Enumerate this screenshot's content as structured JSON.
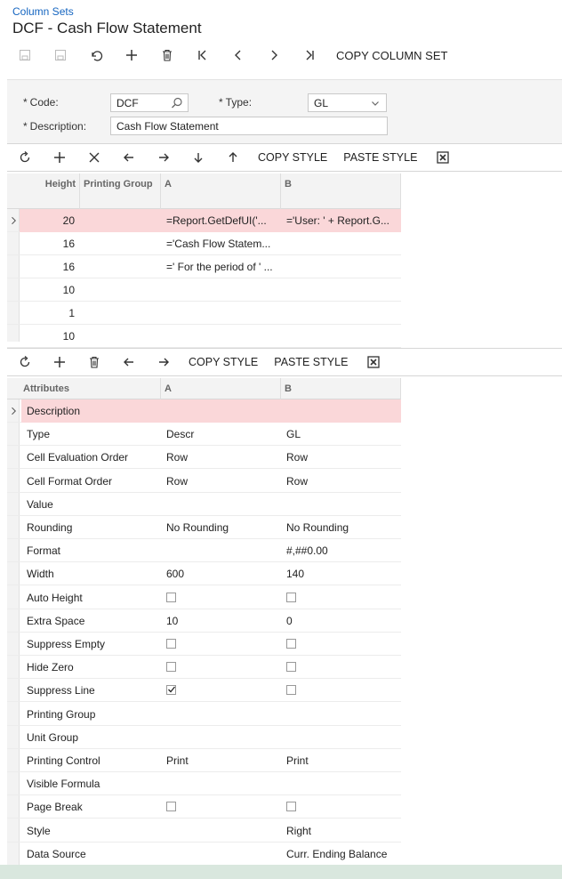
{
  "breadcrumb": "Column Sets",
  "title": "DCF - Cash Flow Statement",
  "main_toolbar": {
    "copy_label": "COPY COLUMN SET"
  },
  "form": {
    "code_label": "Code:",
    "code_value": "DCF",
    "type_label": "Type:",
    "type_value": "GL",
    "description_label": "Description:",
    "description_value": "Cash Flow Statement"
  },
  "top_grid_toolbar": {
    "copy_style": "COPY STYLE",
    "paste_style": "PASTE STYLE"
  },
  "top_grid": {
    "headers": [
      "Height",
      "Printing Group",
      "A",
      "B"
    ],
    "rows": [
      {
        "height": "20",
        "printing_group": "",
        "a": "=Report.GetDefUI('...",
        "b": "='User: ' + Report.G..."
      },
      {
        "height": "16",
        "printing_group": "",
        "a": "='Cash Flow Statem...",
        "b": ""
      },
      {
        "height": "16",
        "printing_group": "",
        "a": "=' For the period of ' ...",
        "b": ""
      },
      {
        "height": "10",
        "printing_group": "",
        "a": "",
        "b": ""
      },
      {
        "height": "1",
        "printing_group": "",
        "a": "",
        "b": ""
      },
      {
        "height": "10",
        "printing_group": "",
        "a": "",
        "b": ""
      }
    ]
  },
  "bottom_grid_toolbar": {
    "copy_style": "COPY STYLE",
    "paste_style": "PASTE STYLE"
  },
  "attr_grid": {
    "headers": [
      "Attributes",
      "A",
      "B"
    ],
    "rows": [
      {
        "attr": "Description",
        "a": "",
        "b": ""
      },
      {
        "attr": "Type",
        "a": "Descr",
        "b": "GL"
      },
      {
        "attr": "Cell Evaluation Order",
        "a": "Row",
        "b": "Row"
      },
      {
        "attr": "Cell Format Order",
        "a": "Row",
        "b": "Row"
      },
      {
        "attr": "Value",
        "a": "",
        "b": ""
      },
      {
        "attr": "Rounding",
        "a": "No Rounding",
        "b": "No Rounding"
      },
      {
        "attr": "Format",
        "a": "",
        "b": "#,##0.00"
      },
      {
        "attr": "Width",
        "a": "600",
        "b": "140"
      },
      {
        "attr": "Auto Height",
        "a_checkbox": false,
        "b_checkbox": false
      },
      {
        "attr": "Extra Space",
        "a": "10",
        "b": "0"
      },
      {
        "attr": "Suppress Empty",
        "a_checkbox": false,
        "b_checkbox": false
      },
      {
        "attr": "Hide Zero",
        "a_checkbox": false,
        "b_checkbox": false
      },
      {
        "attr": "Suppress Line",
        "a_checkbox": true,
        "b_checkbox": false
      },
      {
        "attr": "Printing Group",
        "a": "",
        "b": ""
      },
      {
        "attr": "Unit Group",
        "a": "",
        "b": ""
      },
      {
        "attr": "Printing Control",
        "a": "Print",
        "b": "Print"
      },
      {
        "attr": "Visible Formula",
        "a": "",
        "b": ""
      },
      {
        "attr": "Page Break",
        "a_checkbox": false,
        "b_checkbox": false
      },
      {
        "attr": "Style",
        "a": "",
        "b": "Right"
      },
      {
        "attr": "Data Source",
        "a": "",
        "b": "Curr. Ending Balance"
      }
    ]
  },
  "colors": {
    "link": "#1565c0",
    "active_row": "#fad7d9",
    "panel_bg": "#f4f4f4"
  }
}
